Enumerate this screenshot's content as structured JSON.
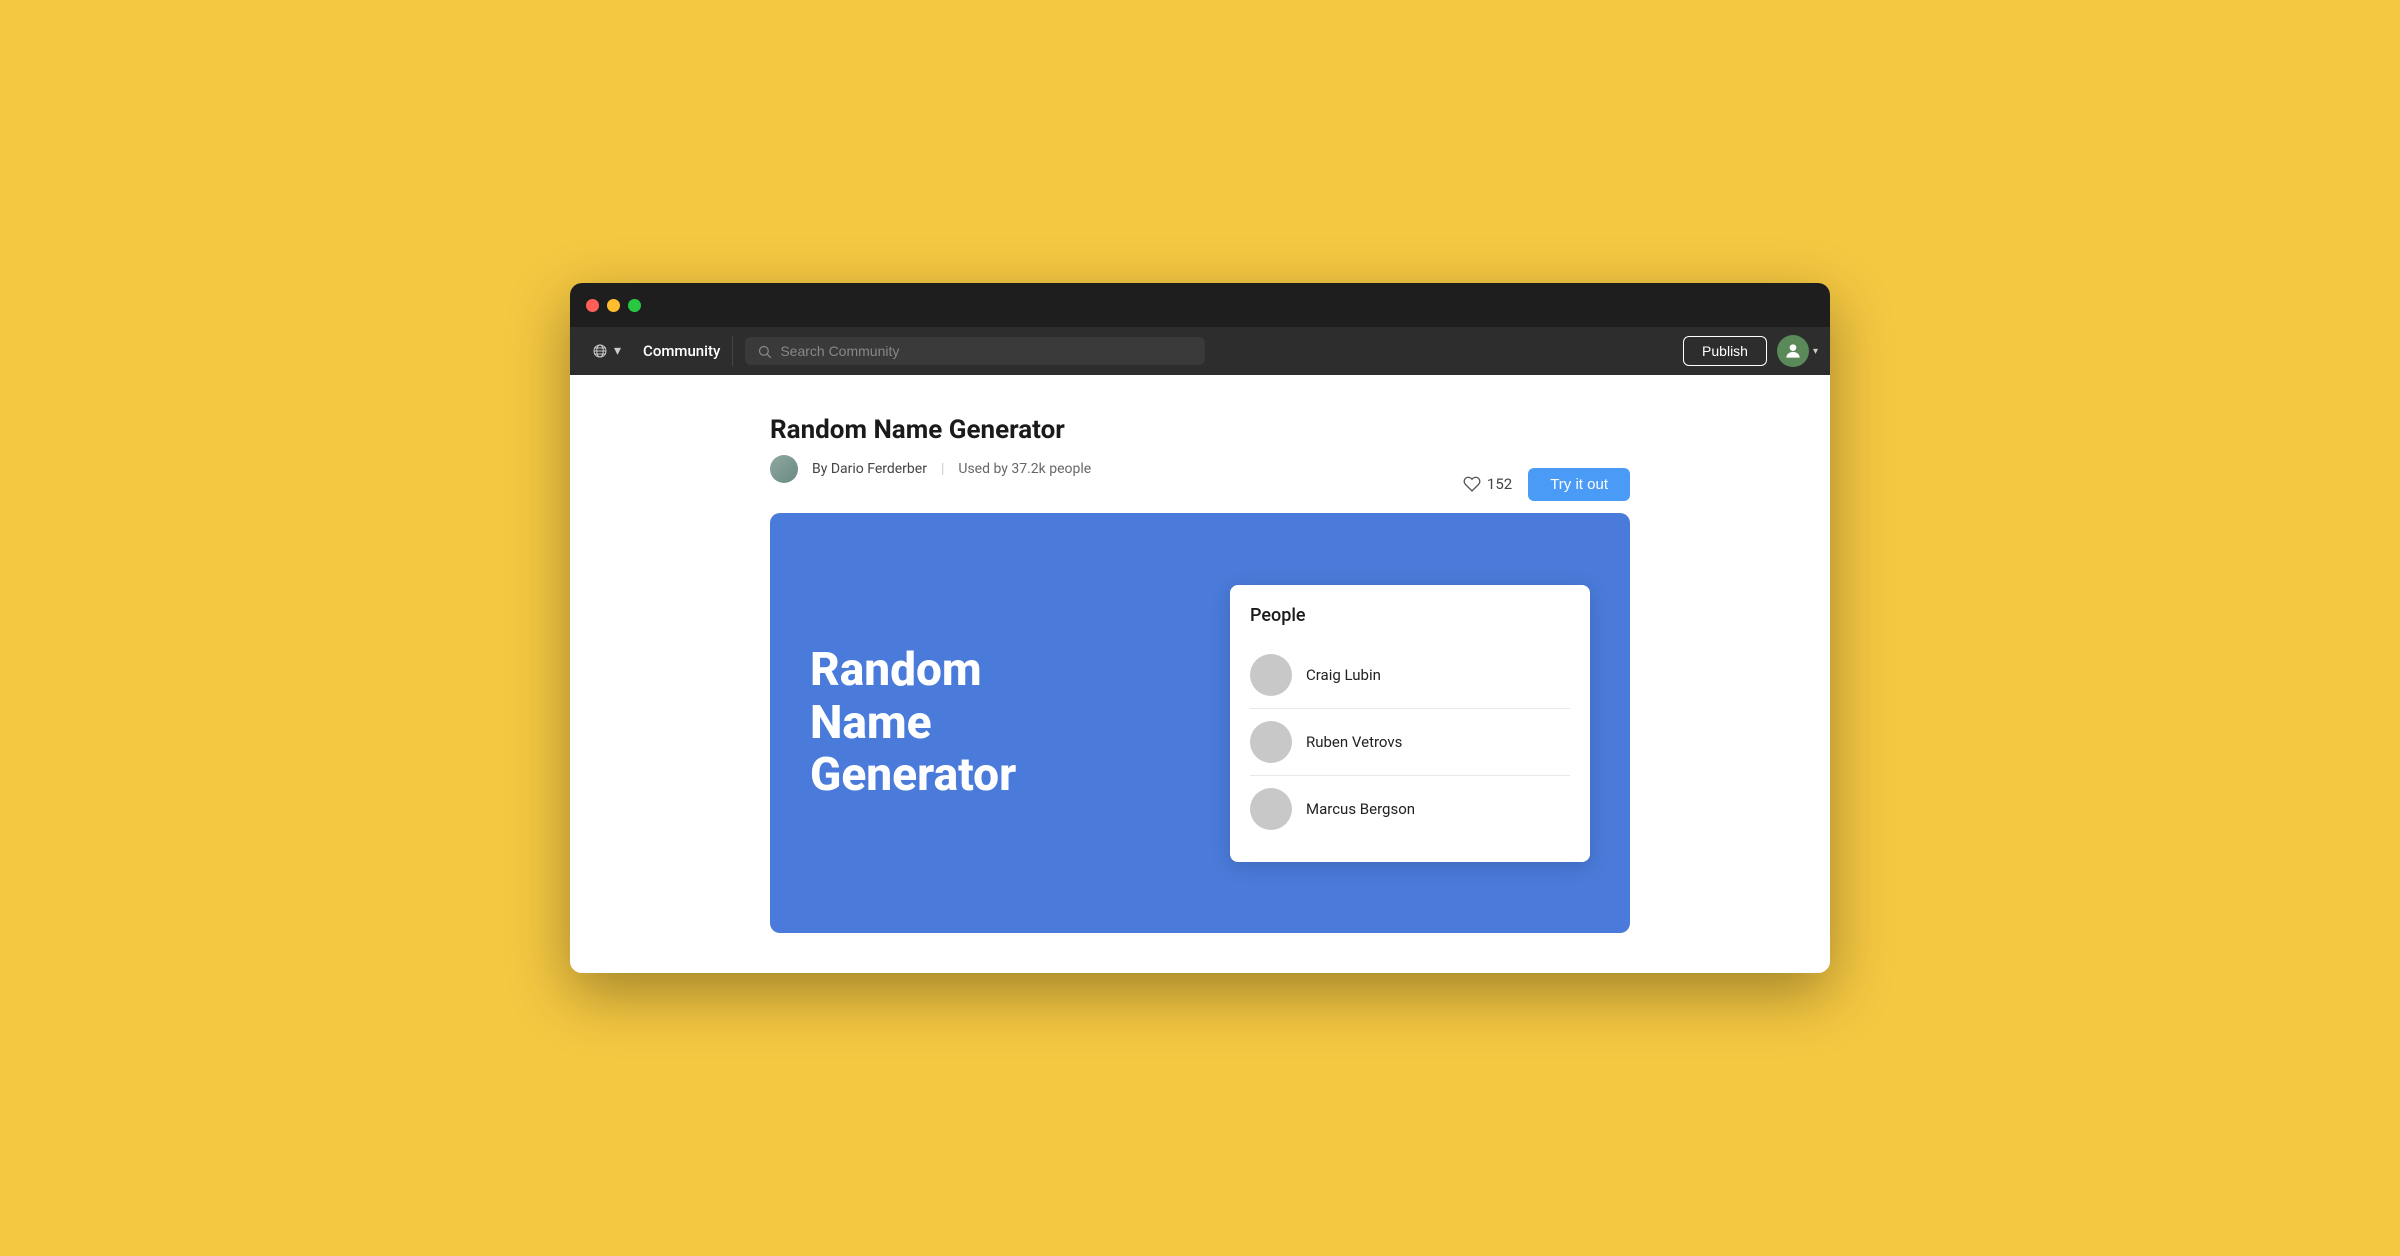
{
  "background": {
    "color": "#F5C842"
  },
  "browser": {
    "title_bar": {
      "close_label": "close",
      "minimize_label": "minimize",
      "maximize_label": "maximize"
    },
    "nav": {
      "globe_label": "Globe",
      "chevron_label": "▾",
      "community_label": "Community",
      "search_placeholder": "Search Community",
      "publish_label": "Publish",
      "avatar_chevron": "▾"
    }
  },
  "page": {
    "app_title": "Random Name Generator",
    "author": "By Dario Ferderber",
    "usage": "Used by 37.2k people",
    "like_count": "152",
    "try_out_label": "Try it out",
    "preview": {
      "big_title_line1": "Random",
      "big_title_line2": "Name",
      "big_title_line3": "Generator",
      "card": {
        "title": "People",
        "people": [
          {
            "name": "Craig Lubin"
          },
          {
            "name": "Ruben Vetrovs"
          },
          {
            "name": "Marcus Bergson"
          }
        ]
      }
    }
  }
}
